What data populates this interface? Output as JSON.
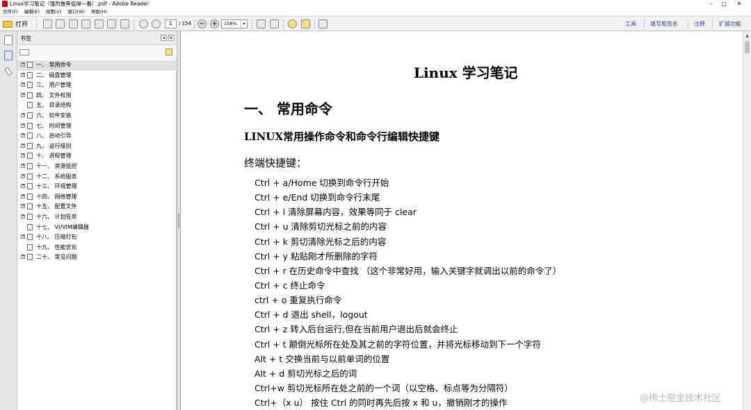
{
  "window": {
    "title": "Linux学习笔记（强烈推荐值得一看）.pdf - Adobe Reader",
    "minimize": "–",
    "maximize": "□",
    "close": "✕"
  },
  "menu": [
    "文件(F)",
    "编辑(E)",
    "视图(V)",
    "窗口(W)",
    "帮助(H)"
  ],
  "toolbar": {
    "open_label": "打开",
    "page_current": "1",
    "page_total": "/ 154",
    "zoom_out": "−",
    "zoom_in": "+",
    "zoom_level": "158%",
    "right_tools": [
      "工具",
      "填写和签名",
      "注释",
      "扩展功能"
    ]
  },
  "bookmarks": {
    "header": "书签",
    "items": [
      {
        "label": "一、 常用命令",
        "expandable": true,
        "selected": true
      },
      {
        "label": "二、 磁盘管理",
        "expandable": true
      },
      {
        "label": "三、 用户管理",
        "expandable": true
      },
      {
        "label": "四、 文件权限",
        "expandable": true
      },
      {
        "label": "五、 目录结构",
        "expandable": false
      },
      {
        "label": "六、 软件安装",
        "expandable": true
      },
      {
        "label": "七、 时间管理",
        "expandable": true
      },
      {
        "label": "八、 启动引导",
        "expandable": true
      },
      {
        "label": "九、 运行级别",
        "expandable": true
      },
      {
        "label": "十、 进程管理",
        "expandable": true
      },
      {
        "label": "十一、 资源监控",
        "expandable": true
      },
      {
        "label": "十二、 系统服务",
        "expandable": true
      },
      {
        "label": "十三、 环境管理",
        "expandable": true
      },
      {
        "label": "十四、 网络管理",
        "expandable": true
      },
      {
        "label": "十五、 配置文件",
        "expandable": true
      },
      {
        "label": "十六、 计划任务",
        "expandable": true
      },
      {
        "label": "十七、 VI/VIM编辑器",
        "expandable": false
      },
      {
        "label": "十八、 压缩打包",
        "expandable": true
      },
      {
        "label": "十九、 性能优化",
        "expandable": false
      },
      {
        "label": "二十、 常见问题",
        "expandable": true
      }
    ]
  },
  "document": {
    "title": "Linux 学习笔记",
    "h1": "一、 常用命令",
    "h2": "LINUX常用操作命令和命令行编辑快捷键",
    "h3": "终端快捷键：",
    "shortcuts": [
      "Ctrl + a/Home  切换到命令行开始",
      "Ctrl + e/End  切换到命令行末尾",
      "Ctrl + l  清除屏幕内容，效果等同于 clear",
      "Ctrl + u  清除剪切光标之前的内容",
      "Ctrl + k  剪切清除光标之后的内容",
      "Ctrl + y  粘贴刚才所删除的字符",
      "Ctrl + r  在历史命令中查找 （这个非常好用，输入关键字就调出以前的命令了）",
      "Ctrl + c  终止命令",
      "ctrl + o  重复执行命令",
      "Ctrl + d  退出 shell，logout",
      "Ctrl + z  转入后台运行,但在当前用户退出后就会终止",
      "Ctrl + t  颠倒光标所在处及其之前的字符位置，并将光标移动到下一个字符",
      "Alt + t  交换当前与以前单词的位置",
      "Alt + d  剪切光标之后的词",
      "Ctrl+w  剪切光标所在处之前的一个词（以空格、标点等为分隔符）",
      "Ctrl+（x u）  按住 Ctrl 的同时再先后按 x 和 u，撤销刚才的操作"
    ]
  },
  "watermark": "@稀土掘金技术社区"
}
